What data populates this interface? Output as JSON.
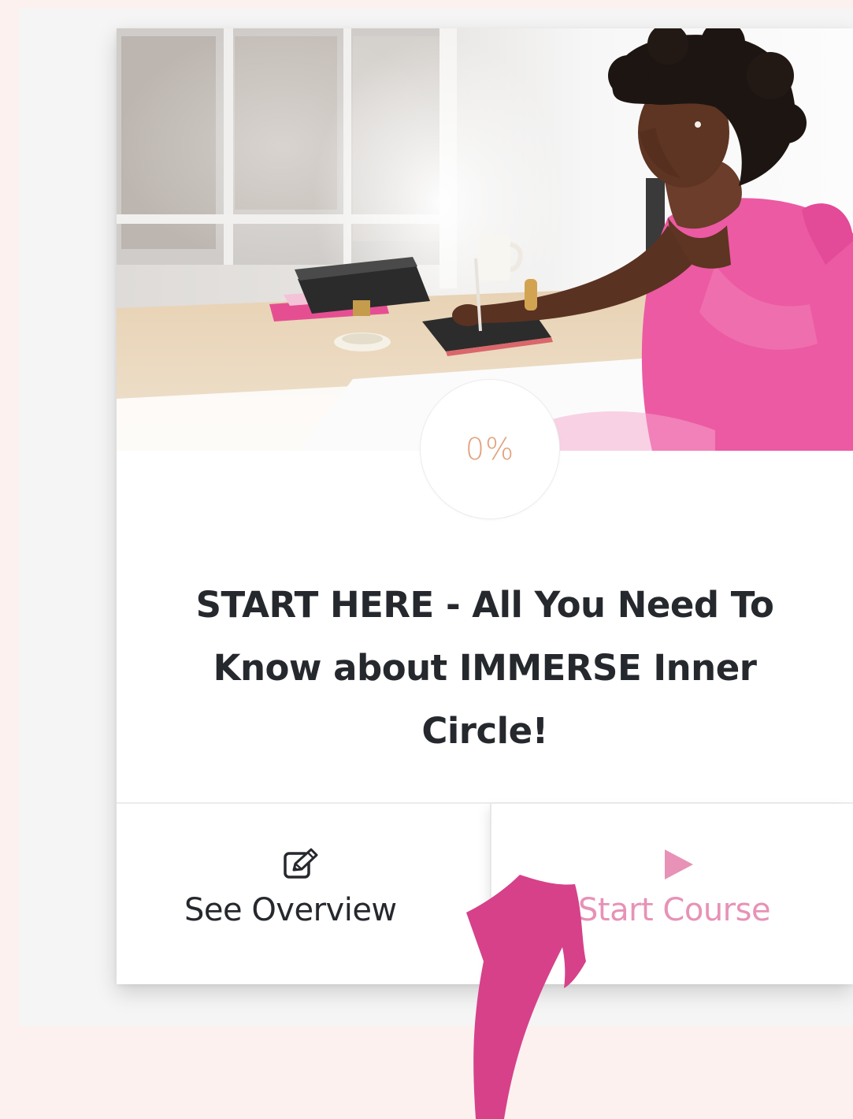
{
  "course": {
    "progress": "0%",
    "progress_value": 0,
    "title": "START HERE - All You Need To Know about IMMERSE Inner Circle!"
  },
  "actions": {
    "overview": {
      "label": "See Overview",
      "icon": "edit-icon"
    },
    "start": {
      "label": "Start Course",
      "icon": "play-icon"
    }
  },
  "colors": {
    "background": "#fdf1f0",
    "panel": "#f5f5f5",
    "title": "#25282d",
    "progress_text": "#e1a27c",
    "start_accent": "#e792b6",
    "arrow": "#d6418a"
  },
  "annotation": {
    "icon": "curved-arrow-icon"
  }
}
